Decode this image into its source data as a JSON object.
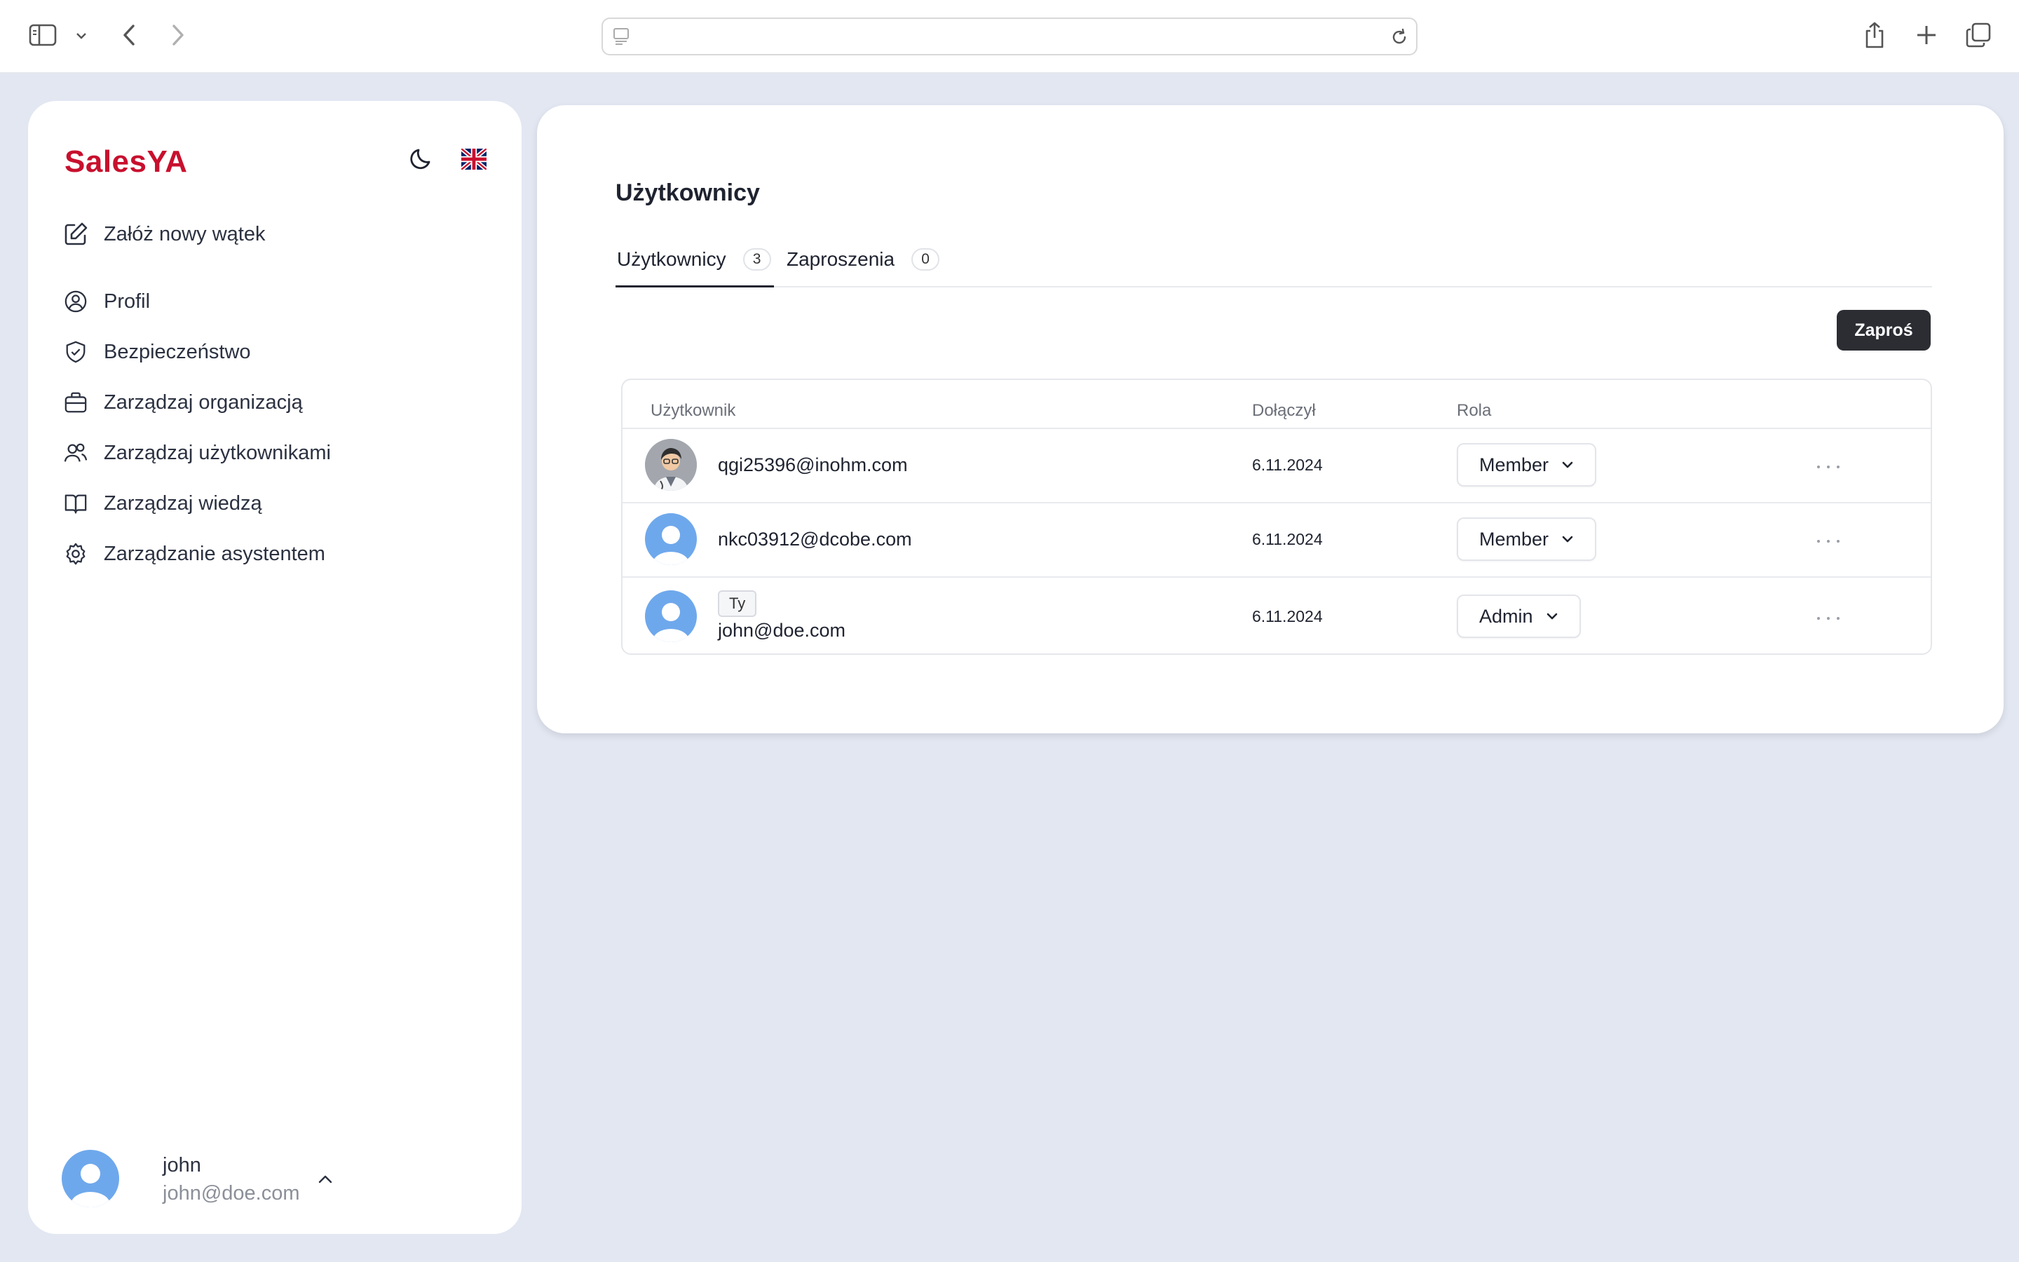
{
  "browser": {
    "address": ""
  },
  "sidebar": {
    "logo": "SalesYA",
    "items": [
      {
        "label": "Załóż nowy wątek",
        "icon": "edit-icon"
      },
      {
        "label": "Profil",
        "icon": "user-circle-icon"
      },
      {
        "label": "Bezpieczeństwo",
        "icon": "shield-check-icon"
      },
      {
        "label": "Zarządzaj organizacją",
        "icon": "briefcase-icon"
      },
      {
        "label": "Zarządzaj użytkownikami",
        "icon": "users-icon"
      },
      {
        "label": "Zarządzaj wiedzą",
        "icon": "book-icon"
      },
      {
        "label": "Zarządzanie asystentem",
        "icon": "gear-icon"
      }
    ],
    "user": {
      "name": "john",
      "email": "john@doe.com"
    }
  },
  "main": {
    "title": "Użytkownicy",
    "tabs": [
      {
        "label": "Użytkownicy",
        "count": "3",
        "active": true
      },
      {
        "label": "Zaproszenia",
        "count": "0",
        "active": false
      }
    ],
    "invite_label": "Zaproś",
    "table": {
      "headers": [
        "Użytkownik",
        "Dołączył",
        "Rola"
      ],
      "rows": [
        {
          "email": "qgi25396@inohm.com",
          "joined": "6.11.2024",
          "role": "Member",
          "avatar": "doctor-avatar"
        },
        {
          "email": "nkc03912@dcobe.com",
          "joined": "6.11.2024",
          "role": "Member",
          "avatar": "default-avatar"
        },
        {
          "email": "john@doe.com",
          "joined": "6.11.2024",
          "role": "Admin",
          "avatar": "default-avatar",
          "badge": "Ty"
        }
      ]
    }
  },
  "colors": {
    "brand": "#c8102e",
    "background": "#e2e7f2",
    "primary_button": "#2b2d33",
    "avatar": "#6ea8ec"
  }
}
